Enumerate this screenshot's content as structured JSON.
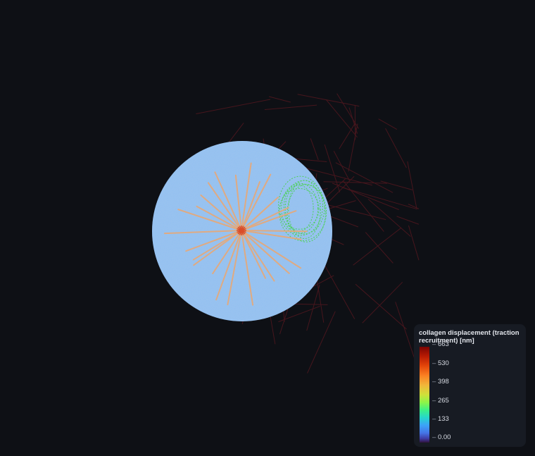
{
  "legend": {
    "title": "collagen displacement (traction recruitment) [nm]",
    "ticks": [
      "663",
      "530",
      "398",
      "265",
      "133",
      "0.00"
    ]
  },
  "colors": {
    "background": "#0e1015",
    "cell_body": "#91bff0",
    "protrusions": "#e8a876",
    "nucleus_center": "#d94d2a",
    "green_mesh": "#4ed15a",
    "collagen_fibers": "#5a1820"
  }
}
